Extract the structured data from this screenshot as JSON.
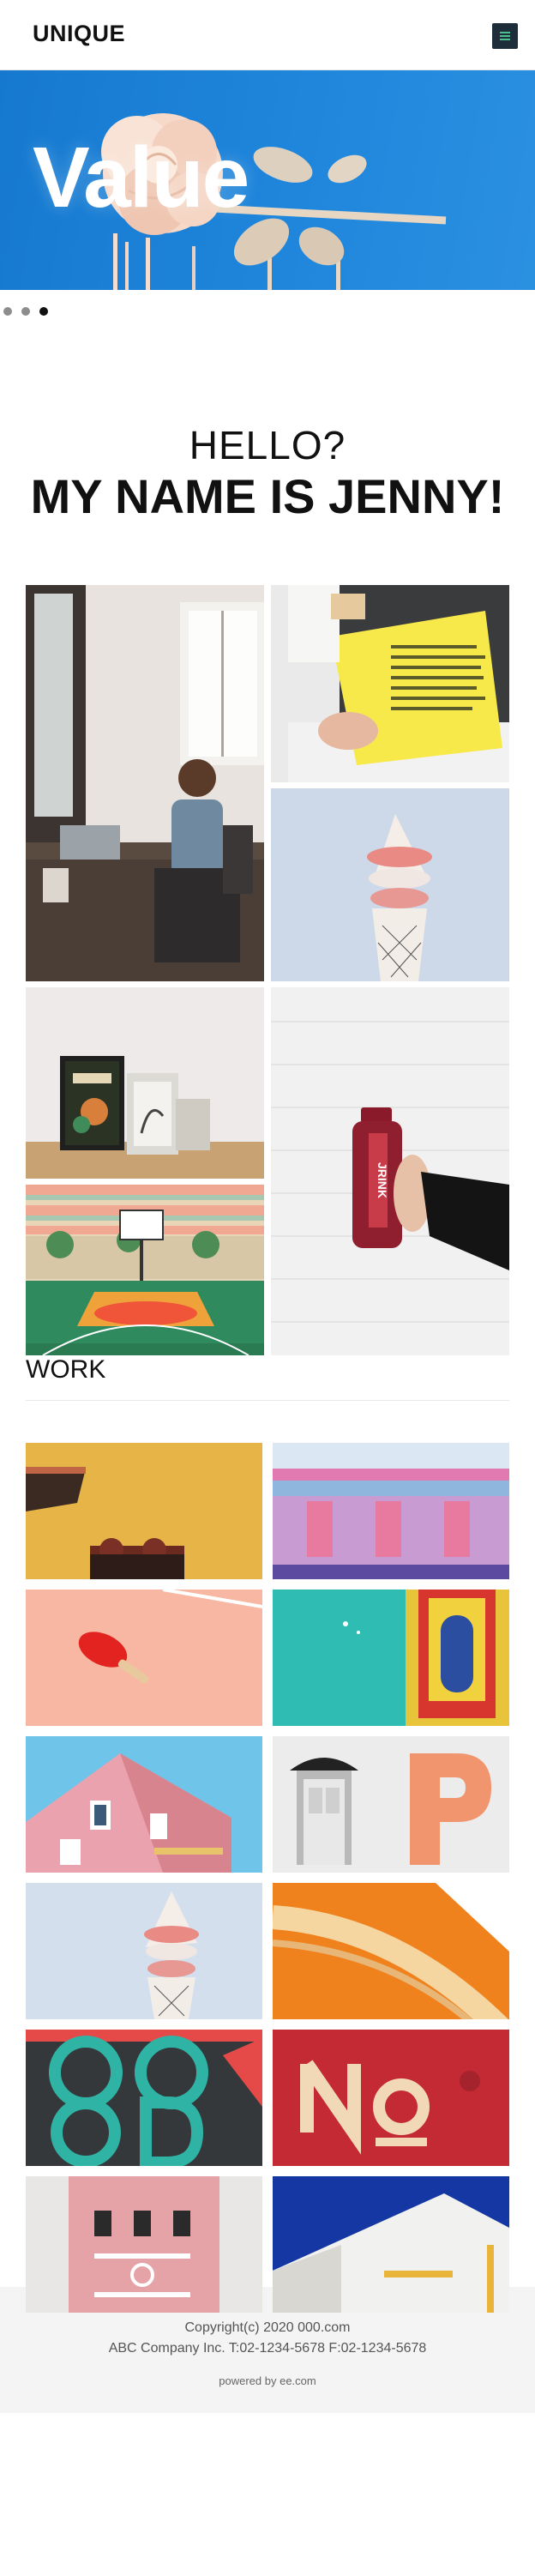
{
  "header": {
    "logo": "UNIQUE",
    "menu_icon": "hamburger-icon",
    "menu_color": "#1e2d3a",
    "menu_bar_color": "#49c08e"
  },
  "hero": {
    "word": "Value",
    "background": "#1f86dc",
    "image": "pale pink rose"
  },
  "slider": {
    "dot_count": 3,
    "active_index": 3
  },
  "intro": {
    "greeting": "HELLO?",
    "name_line": "MY NAME IS JENNY!"
  },
  "gallery": {
    "images": [
      "woman-at-laptop",
      "yellow-magazine",
      "ice-cream-cone",
      "framed-posters",
      "juice-bottle",
      "basketball-court"
    ]
  },
  "work": {
    "title": "WORK",
    "images": [
      "yellow-wall",
      "pastel-building",
      "ping-pong-paddle",
      "teal-wall-window",
      "pink-house",
      "door-letter-p",
      "ice-cream-cone",
      "orange-curve",
      "good-mural",
      "no-sign",
      "pink-facade",
      "blue-sky-building"
    ]
  },
  "footer": {
    "copyright": "Copyright(c) 2020 000.com",
    "company": "ABC Company Inc. T:02-1234-5678 F:02-1234-5678",
    "powered": "powered by ee.com"
  }
}
